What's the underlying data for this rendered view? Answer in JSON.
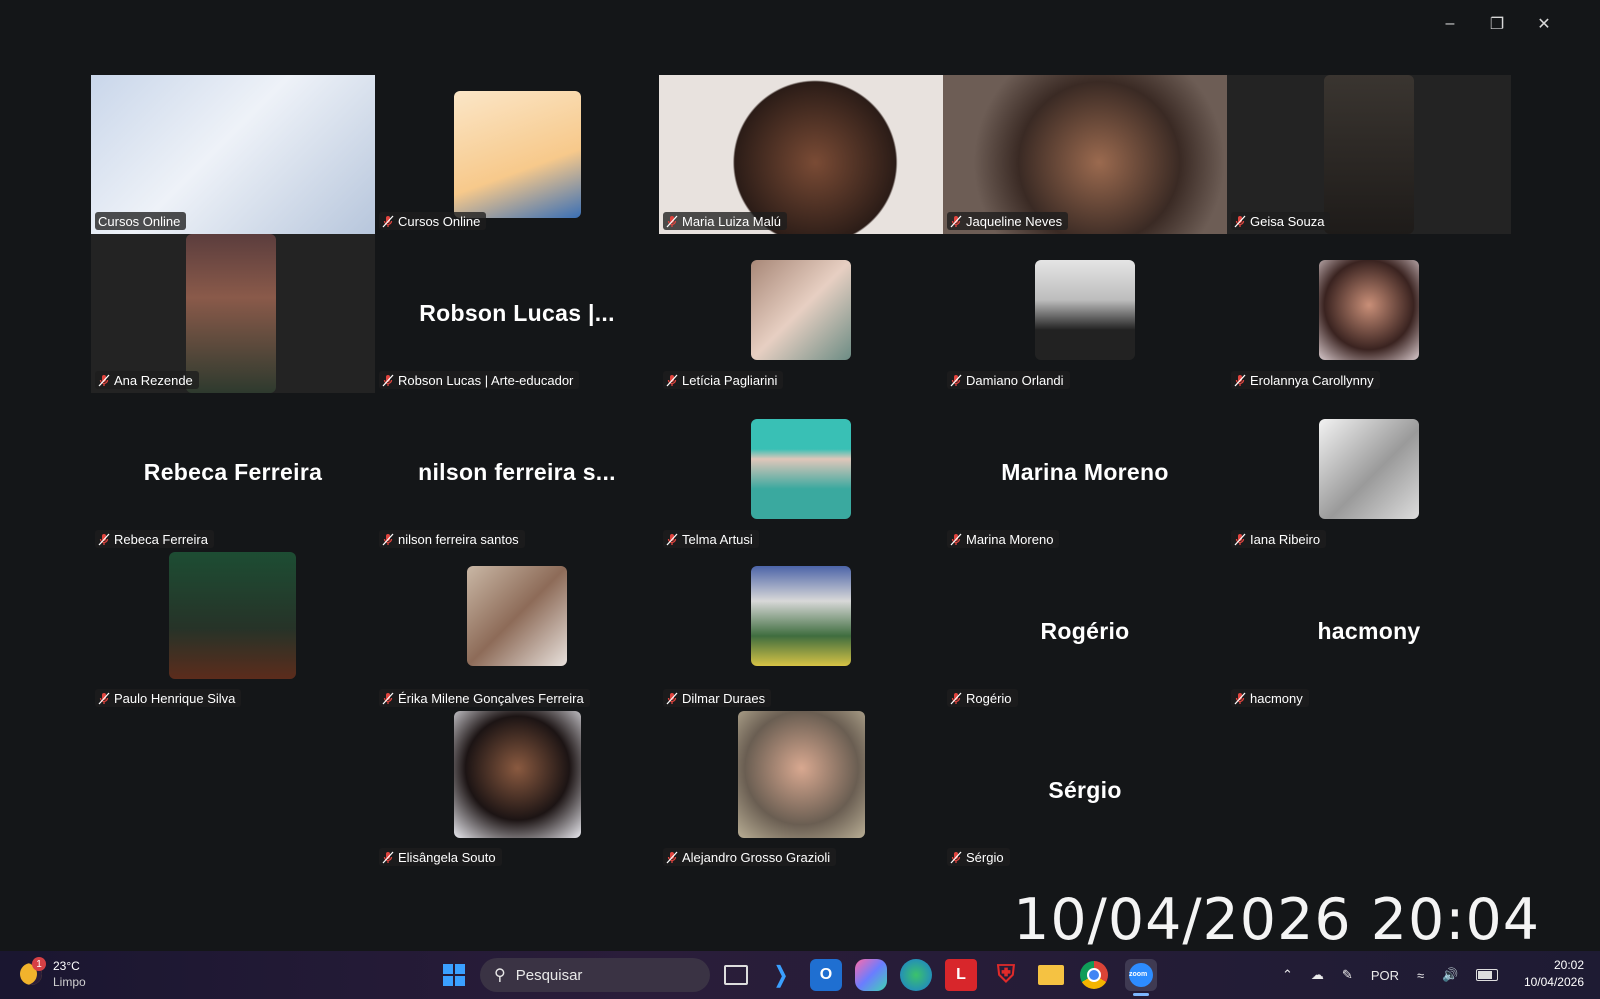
{
  "window_controls": {
    "minimize": "–",
    "restore": "❐",
    "close": "✕"
  },
  "participants": [
    {
      "name": "Cursos Online",
      "kind": "video",
      "active": true,
      "muted": false
    },
    {
      "name": "Cursos Online",
      "kind": "image",
      "muted": true
    },
    {
      "name": "Maria Luiza Malú",
      "kind": "video",
      "muted": true
    },
    {
      "name": "Jaqueline Neves",
      "kind": "video",
      "muted": true
    },
    {
      "name": "Geisa Souza",
      "kind": "video",
      "muted": true
    },
    {
      "name": "Ana Rezende",
      "kind": "video",
      "muted": true
    },
    {
      "name": "Robson Lucas | Arte-educador",
      "display": "Robson Lucas |...",
      "kind": "name",
      "muted": true
    },
    {
      "name": "Letícia Pagliarini",
      "kind": "avatar",
      "muted": true
    },
    {
      "name": "Damiano Orlandi",
      "kind": "avatar",
      "muted": true
    },
    {
      "name": "Erolannya Carollynny",
      "kind": "avatar",
      "muted": true
    },
    {
      "name": "Rebeca Ferreira",
      "display": "Rebeca Ferreira",
      "kind": "name",
      "muted": true
    },
    {
      "name": "nilson ferreira santos",
      "display": "nilson ferreira s...",
      "kind": "name",
      "muted": true
    },
    {
      "name": "Telma Artusi",
      "kind": "avatar",
      "muted": true
    },
    {
      "name": "Marina Moreno",
      "display": "Marina Moreno",
      "kind": "name",
      "muted": true
    },
    {
      "name": "Iana Ribeiro",
      "kind": "avatar",
      "muted": true
    },
    {
      "name": "Paulo Henrique Silva",
      "kind": "avatar",
      "muted": true
    },
    {
      "name": "Érika Milene Gonçalves Ferreira",
      "kind": "avatar",
      "muted": true
    },
    {
      "name": "Dilmar Duraes",
      "kind": "avatar",
      "muted": true
    },
    {
      "name": "Rogério",
      "display": "Rogério",
      "kind": "name",
      "muted": true
    },
    {
      "name": "hacmony",
      "display": "hacmony",
      "kind": "name",
      "muted": true
    },
    {
      "name": "Elisângela Souto",
      "kind": "avatar",
      "muted": true
    },
    {
      "name": "Alejandro Grosso Grazioli",
      "kind": "avatar",
      "muted": true
    },
    {
      "name": "Sérgio",
      "display": "Sérgio",
      "kind": "name",
      "muted": true
    }
  ],
  "timestamp_overlay": "10/04/2026 20:04",
  "taskbar": {
    "weather": {
      "temp": "23°C",
      "condition": "Limpo",
      "badge": "1"
    },
    "search_placeholder": "Pesquisar",
    "pinned": [
      "windows-start",
      "task-view",
      "vscode",
      "outlook",
      "copilot",
      "edge",
      "app-l",
      "mcafee",
      "file-explorer",
      "chrome",
      "zoom"
    ],
    "language": "POR",
    "time": "20:02",
    "date": "10/04/2026"
  },
  "colors": {
    "active_speaker": "#37d67a",
    "muted_mic": "#e0443e",
    "background": "#141618"
  }
}
